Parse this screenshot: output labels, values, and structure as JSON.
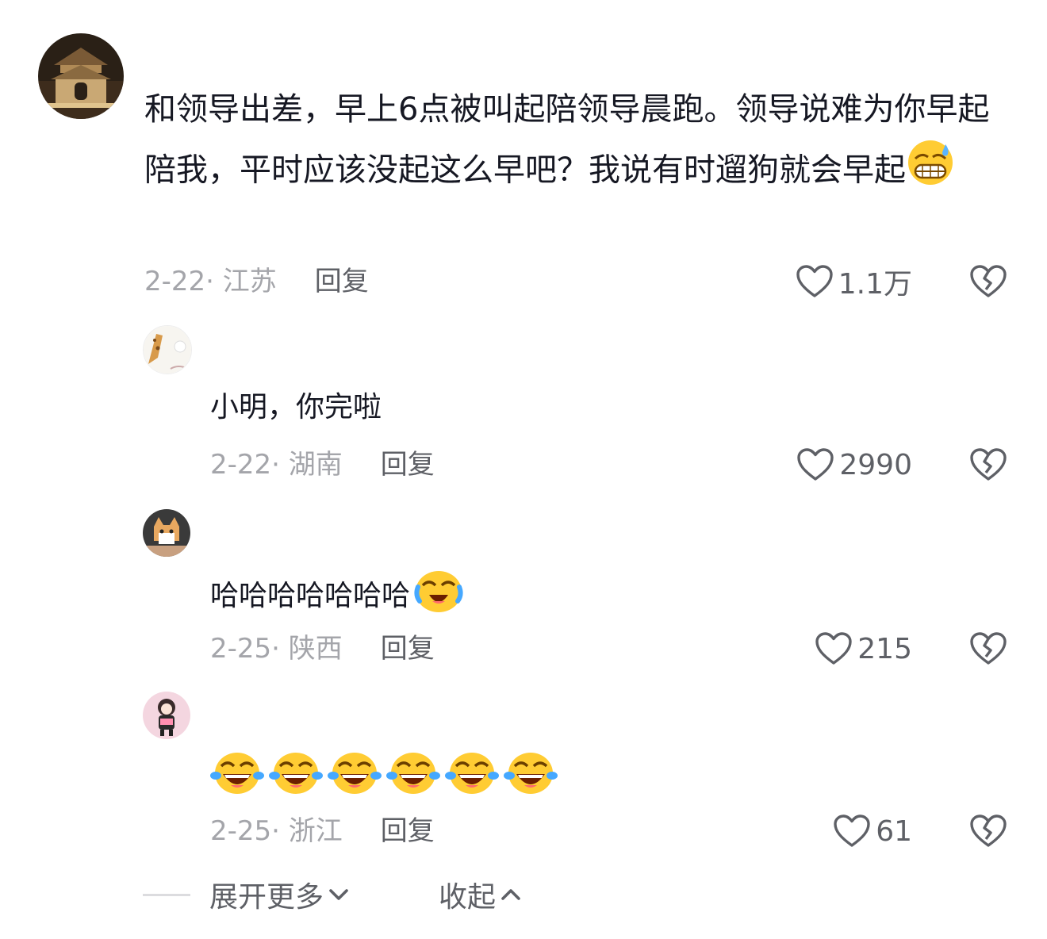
{
  "comments": [
    {
      "text": "和领导出差，早上6点被叫起陪领导晨跑。领导说难为你早起陪我，平时应该没起这么早吧？我说有时遛狗就会早起",
      "emoji": "grinning-sweat-emoji",
      "date": "2-22",
      "location": "江苏",
      "reply_label": "回复",
      "likes": "1.1万"
    }
  ],
  "replies": [
    {
      "text": "小明，你完啦",
      "date": "2-22",
      "location": "湖南",
      "reply_label": "回复",
      "likes": "2990"
    },
    {
      "text": "哈哈哈哈哈哈哈",
      "emoji": "crying-laughing-emoji",
      "date": "2-25",
      "location": "陕西",
      "reply_label": "回复",
      "likes": "215"
    },
    {
      "text": "",
      "emoji": "tears-of-joy-emoji",
      "emoji_count": 6,
      "date": "2-25",
      "location": "浙江",
      "reply_label": "回复",
      "likes": "61"
    }
  ],
  "footer": {
    "expand_label": "展开更多",
    "collapse_label": "收起"
  },
  "colors": {
    "text": "#161823",
    "meta": "#a4a5aa",
    "action": "#5e6066"
  }
}
